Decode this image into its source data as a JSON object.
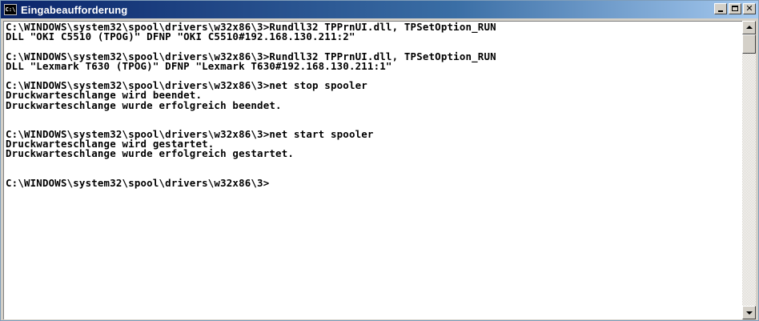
{
  "window": {
    "title": "Eingabeaufforderung",
    "icon": "cmd-icon",
    "icon_text": "C:\\",
    "controls": {
      "minimize": "minimize-icon",
      "maximize": "maximize-icon",
      "close": "close-icon",
      "close_glyph": "✕"
    }
  },
  "colors": {
    "console_background": "#ffffff",
    "console_text": "#000000",
    "titlebar_start": "#0a246a",
    "titlebar_end": "#a6caf0",
    "chrome": "#d4d0c8"
  },
  "console": {
    "lines": [
      "C:\\WINDOWS\\system32\\spool\\drivers\\w32x86\\3>Rundll32 TPPrnUI.dll, TPSetOption_RUN",
      "DLL \"OKI C5510 (TPOG)\" DFNP \"OKI C5510#192.168.130.211:2\"",
      "",
      "C:\\WINDOWS\\system32\\spool\\drivers\\w32x86\\3>Rundll32 TPPrnUI.dll, TPSetOption_RUN",
      "DLL \"Lexmark T630 (TPOG)\" DFNP \"Lexmark T630#192.168.130.211:1\"",
      "",
      "C:\\WINDOWS\\system32\\spool\\drivers\\w32x86\\3>net stop spooler",
      "Druckwarteschlange wird beendet.",
      "Druckwarteschlange wurde erfolgreich beendet.",
      "",
      "",
      "C:\\WINDOWS\\system32\\spool\\drivers\\w32x86\\3>net start spooler",
      "Druckwarteschlange wird gestartet.",
      "Druckwarteschlange wurde erfolgreich gestartet.",
      "",
      "",
      "C:\\WINDOWS\\system32\\spool\\drivers\\w32x86\\3>"
    ]
  },
  "scrollbar": {
    "up_icon": "arrow-up-icon",
    "down_icon": "arrow-down-icon"
  }
}
